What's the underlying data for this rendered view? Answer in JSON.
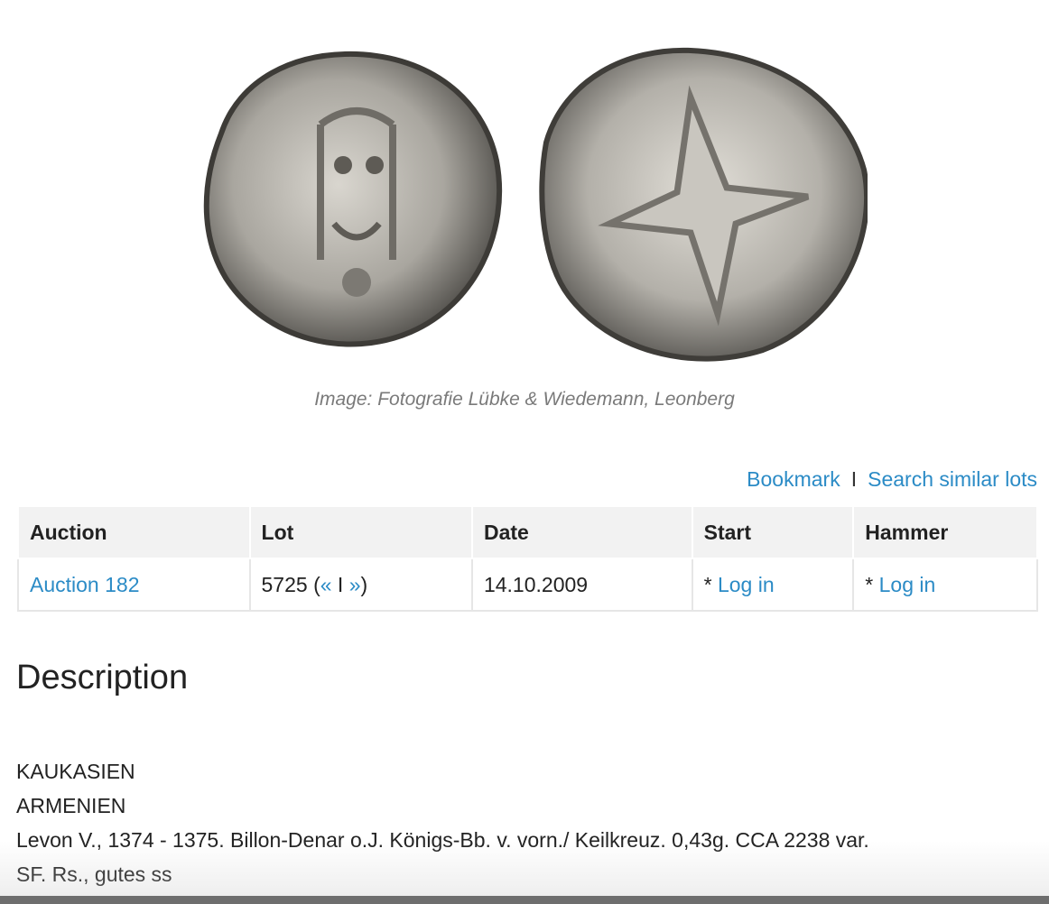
{
  "image": {
    "alt": "coin-obverse-and-reverse",
    "caption": "Image: Fotografie Lübke & Wiedemann, Leonberg"
  },
  "actions": {
    "bookmark": "Bookmark",
    "separator": "I",
    "search_similar": "Search similar lots"
  },
  "table": {
    "headers": [
      "Auction",
      "Lot",
      "Date",
      "Start",
      "Hammer"
    ],
    "row": {
      "auction": "Auction 182",
      "lot_number": "5725",
      "lot_open": " (",
      "prev": "«",
      "nav_sep": " I ",
      "next": "»",
      "lot_close": ")",
      "date": "14.10.2009",
      "start_prefix": "* ",
      "start_link": "Log in",
      "hammer_prefix": "* ",
      "hammer_link": "Log in"
    }
  },
  "description": {
    "title": "Description",
    "lines": [
      "KAUKASIEN",
      "ARMENIEN",
      "Levon V., 1374 - 1375. Billon-Denar o.J. Königs-Bb. v. vorn./ Keilkreuz. 0,43g. CCA 2238 var.",
      "SF. Rs., gutes ss"
    ]
  },
  "colors": {
    "link": "#2b8bc6",
    "header_bg": "#f2f2f2",
    "caption": "#7a7a7a"
  }
}
